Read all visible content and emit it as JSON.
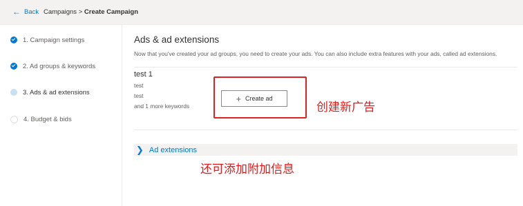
{
  "header": {
    "back_icon": "arrow-left-icon",
    "back_label": "Back",
    "breadcrumb_link": "Campaigns",
    "breadcrumb_separator": ">",
    "breadcrumb_current": "Create Campaign"
  },
  "steps": [
    {
      "label": "1. Campaign settings",
      "status": "complete"
    },
    {
      "label": "2. Ad groups & keywords",
      "status": "complete"
    },
    {
      "label": "3. Ads & ad extensions",
      "status": "current"
    },
    {
      "label": "4. Budget & bids",
      "status": "pending"
    }
  ],
  "main": {
    "title": "Ads & ad extensions",
    "description": "Now that you've created your ad groups, you need to create your ads. You can also include extra features with your ads, called ad extensions.",
    "ad_group": {
      "name": "test 1",
      "keywords": [
        "test",
        "test"
      ],
      "more_keywords": "and 1 more keywords"
    },
    "create_ad_icon": "plus-icon",
    "create_ad_label": "Create ad",
    "extensions_icon": "chevron-right-icon",
    "extensions_label": "Ad extensions"
  },
  "annotations": {
    "create_ad_note": "创建新广告",
    "extensions_note": "还可添加附加信息",
    "highlight_color": "#e02020"
  },
  "colors": {
    "accent": "#0078d4",
    "annotation": "#e81818"
  }
}
